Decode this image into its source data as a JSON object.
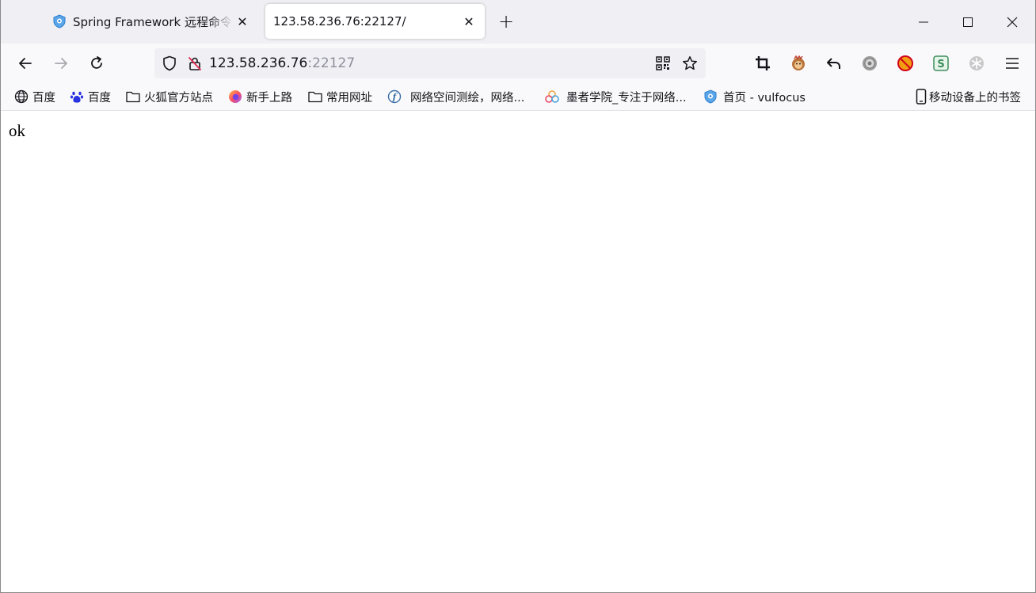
{
  "tabs": [
    {
      "title": "Spring Framework 远程命令执",
      "close_glyph": "✕",
      "active": false,
      "favicon": "vulfocus-shield-icon"
    },
    {
      "title": "123.58.236.76:22127/",
      "close_glyph": "✕",
      "active": true
    }
  ],
  "new_tab_glyph": "+",
  "urlbar": {
    "host": "123.58.236.76",
    "port": ":22127"
  },
  "bookmarks": [
    {
      "label": "百度",
      "icon": "globe-icon"
    },
    {
      "label": "百度",
      "icon": "baidu-paw-icon"
    },
    {
      "label": "火狐官方站点",
      "icon": "folder-icon"
    },
    {
      "label": "新手上路",
      "icon": "firefox-icon"
    },
    {
      "label": "常用网址",
      "icon": "folder-icon"
    },
    {
      "label": "网络空间测绘，网络...",
      "icon": "fofa-icon"
    },
    {
      "label": "墨者学院_专注于网络...",
      "icon": "mozhe-cloud-icon"
    },
    {
      "label": "首页 - vulfocus",
      "icon": "vulfocus-shield-icon"
    },
    {
      "label": "移动设备上的书签",
      "icon": "mobile-device-icon"
    }
  ],
  "page": {
    "body_text": "ok"
  },
  "colors": {
    "accent": "#0060df",
    "tabstrip_bg": "#f0f0f4",
    "toolbar_bg": "#f9f9fb"
  }
}
